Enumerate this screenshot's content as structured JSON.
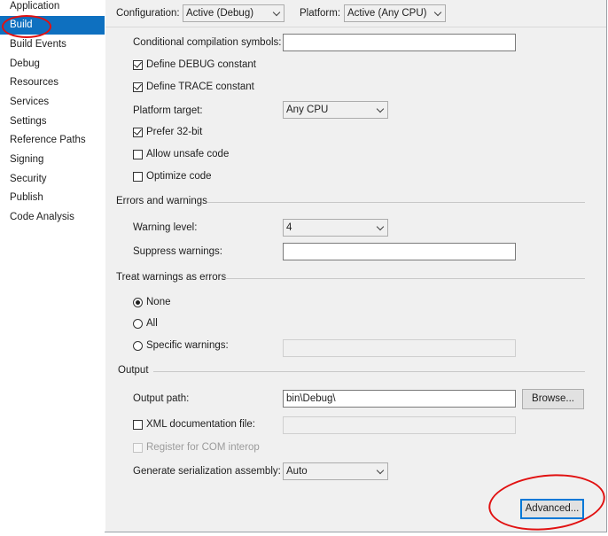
{
  "sidebar": {
    "items": [
      {
        "label": "Application"
      },
      {
        "label": "Build"
      },
      {
        "label": "Build Events"
      },
      {
        "label": "Debug"
      },
      {
        "label": "Resources"
      },
      {
        "label": "Services"
      },
      {
        "label": "Settings"
      },
      {
        "label": "Reference Paths"
      },
      {
        "label": "Signing"
      },
      {
        "label": "Security"
      },
      {
        "label": "Publish"
      },
      {
        "label": "Code Analysis"
      }
    ],
    "selected": "Build"
  },
  "top": {
    "configuration_label": "Configuration:",
    "configuration_value": "Active (Debug)",
    "platform_label": "Platform:",
    "platform_value": "Active (Any CPU)"
  },
  "general": {
    "conditional_symbols_label": "Conditional compilation symbols:",
    "conditional_symbols_value": "",
    "define_debug_label": "Define DEBUG constant",
    "define_debug_checked": true,
    "define_trace_label": "Define TRACE constant",
    "define_trace_checked": true,
    "platform_target_label": "Platform target:",
    "platform_target_value": "Any CPU",
    "prefer32_label": "Prefer 32-bit",
    "prefer32_checked": true,
    "unsafe_label": "Allow unsafe code",
    "unsafe_checked": false,
    "optimize_label": "Optimize code",
    "optimize_checked": false
  },
  "errors": {
    "section_label": "Errors and warnings",
    "warning_level_label": "Warning level:",
    "warning_level_value": "4",
    "suppress_label": "Suppress warnings:",
    "suppress_value": ""
  },
  "treat": {
    "section_label": "Treat warnings as errors",
    "none_label": "None",
    "all_label": "All",
    "specific_label": "Specific warnings:",
    "selected": "None",
    "specific_value": ""
  },
  "output": {
    "section_label": "Output",
    "output_path_label": "Output path:",
    "output_path_value": "bin\\Debug\\",
    "browse_label": "Browse...",
    "xml_doc_label": "XML documentation file:",
    "xml_doc_checked": false,
    "xml_doc_value": "",
    "com_interop_label": "Register for COM interop",
    "com_interop_checked": false,
    "serialization_label": "Generate serialization assembly:",
    "serialization_value": "Auto"
  },
  "footer": {
    "advanced_label": "Advanced..."
  },
  "colors": {
    "accent": "#0e70c0",
    "annotation": "#e11111",
    "panel_bg": "#f0f0f0"
  }
}
